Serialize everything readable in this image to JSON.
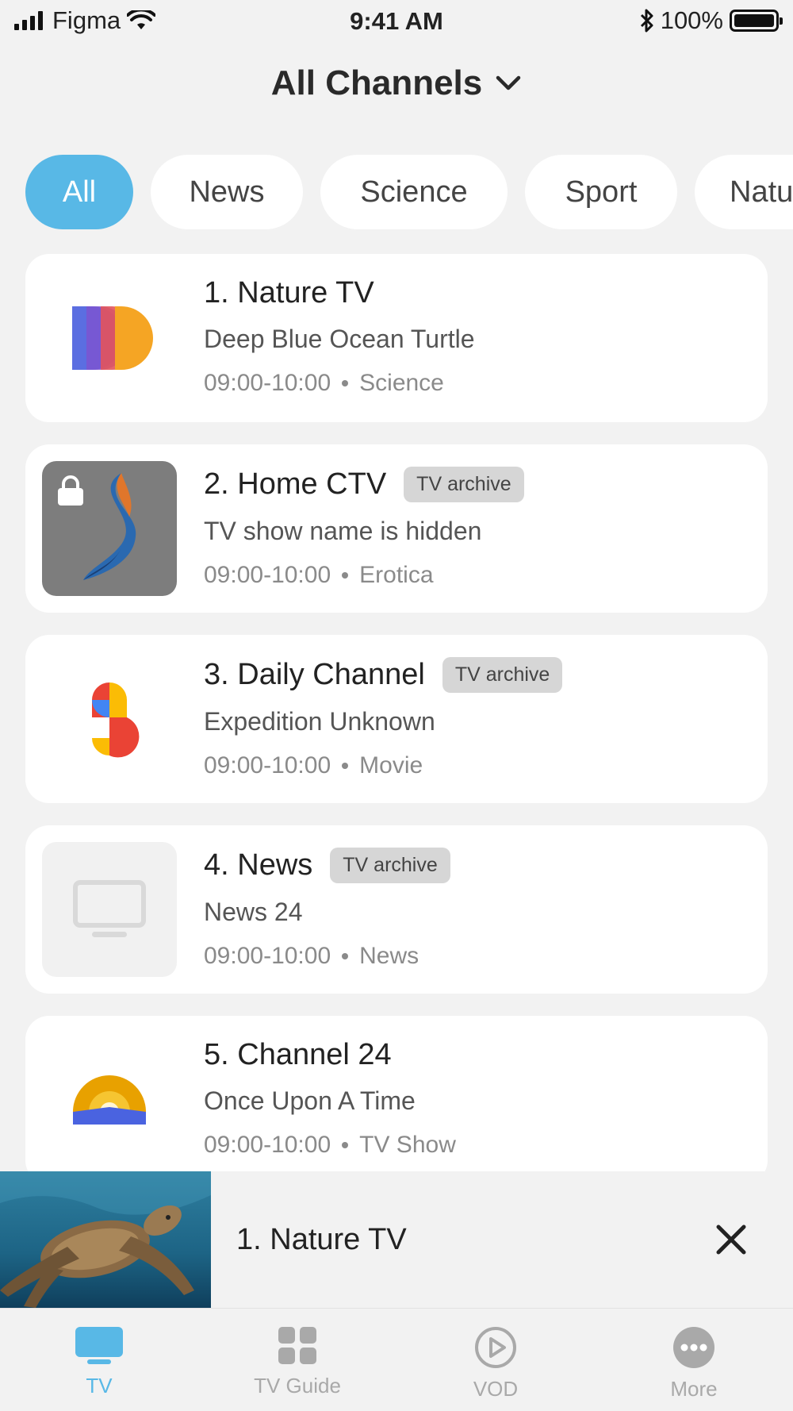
{
  "status_bar": {
    "carrier": "Figma",
    "time": "9:41 AM",
    "battery": "100%"
  },
  "header": {
    "title": "All Channels"
  },
  "filters": [
    {
      "label": "All",
      "active": true
    },
    {
      "label": "News",
      "active": false
    },
    {
      "label": "Science",
      "active": false
    },
    {
      "label": "Sport",
      "active": false
    },
    {
      "label": "Natu",
      "active": false
    }
  ],
  "channels": [
    {
      "title": "1. Nature TV",
      "show": "Deep Blue Ocean Turtle",
      "time": "09:00-10:00",
      "category": "Science",
      "badge": ""
    },
    {
      "title": "2. Home CTV",
      "show": "TV show name is hidden",
      "time": "09:00-10:00",
      "category": "Erotica",
      "badge": "TV archive"
    },
    {
      "title": "3. Daily Channel",
      "show": "Expedition Unknown",
      "time": "09:00-10:00",
      "category": "Movie",
      "badge": "TV archive"
    },
    {
      "title": "4. News",
      "show": "News 24",
      "time": "09:00-10:00",
      "category": "News",
      "badge": "TV archive"
    },
    {
      "title": "5. Channel 24",
      "show": "Once Upon A Time",
      "time": "09:00-10:00",
      "category": "TV Show",
      "badge": ""
    }
  ],
  "mini_player": {
    "title": "1. Nature TV"
  },
  "tabs": [
    {
      "label": "TV",
      "icon": "tv-icon",
      "active": true
    },
    {
      "label": "TV Guide",
      "icon": "grid-icon",
      "active": false
    },
    {
      "label": "VOD",
      "icon": "play-circle-icon",
      "active": false
    },
    {
      "label": "More",
      "icon": "more-icon",
      "active": false
    }
  ],
  "colors": {
    "accent": "#58b8e6",
    "background": "#f2f2f2",
    "card": "#ffffff",
    "badge": "#d6d6d6"
  }
}
